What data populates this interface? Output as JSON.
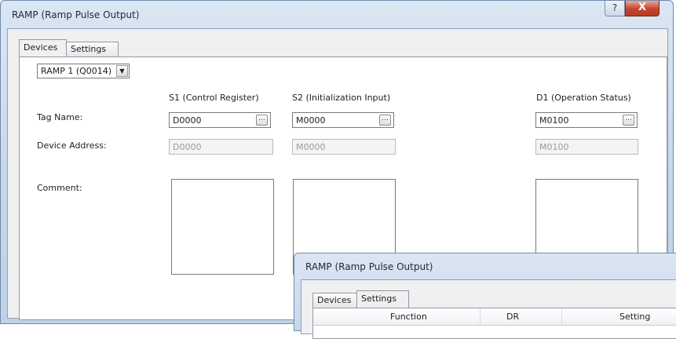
{
  "main_window": {
    "title": "RAMP (Ramp Pulse Output)",
    "help_glyph": "?",
    "close_glyph": "X"
  },
  "tabs": [
    {
      "label": "Devices",
      "active": true
    },
    {
      "label": "Settings",
      "active": false
    }
  ],
  "instance_select": {
    "selected": "RAMP 1 (Q0014)",
    "arrow_icon": "chevron-down-icon"
  },
  "columns": {
    "s1": "S1 (Control Register)",
    "s2": "S2 (Initialization Input)",
    "d1": "D1 (Operation Status)"
  },
  "row_labels": {
    "tag_name": "Tag Name:",
    "device_address": "Device Address:",
    "comment": "Comment:"
  },
  "tag_names": {
    "s1": "D0000",
    "s2": "M0000",
    "d1": "M0100"
  },
  "device_addresses": {
    "s1": "D0000",
    "s2": "M0000",
    "d1": "M0100"
  },
  "browse_button": "...",
  "second_window": {
    "title": "RAMP (Ramp Pulse Output)",
    "tabs": [
      {
        "label": "Devices",
        "active": false
      },
      {
        "label": "Settings",
        "active": true
      }
    ],
    "grid_headers": [
      "Function",
      "DR",
      "Setting"
    ]
  },
  "colors": {
    "close_button": "#c5432c",
    "title_gradient": "#dbe6f3"
  }
}
